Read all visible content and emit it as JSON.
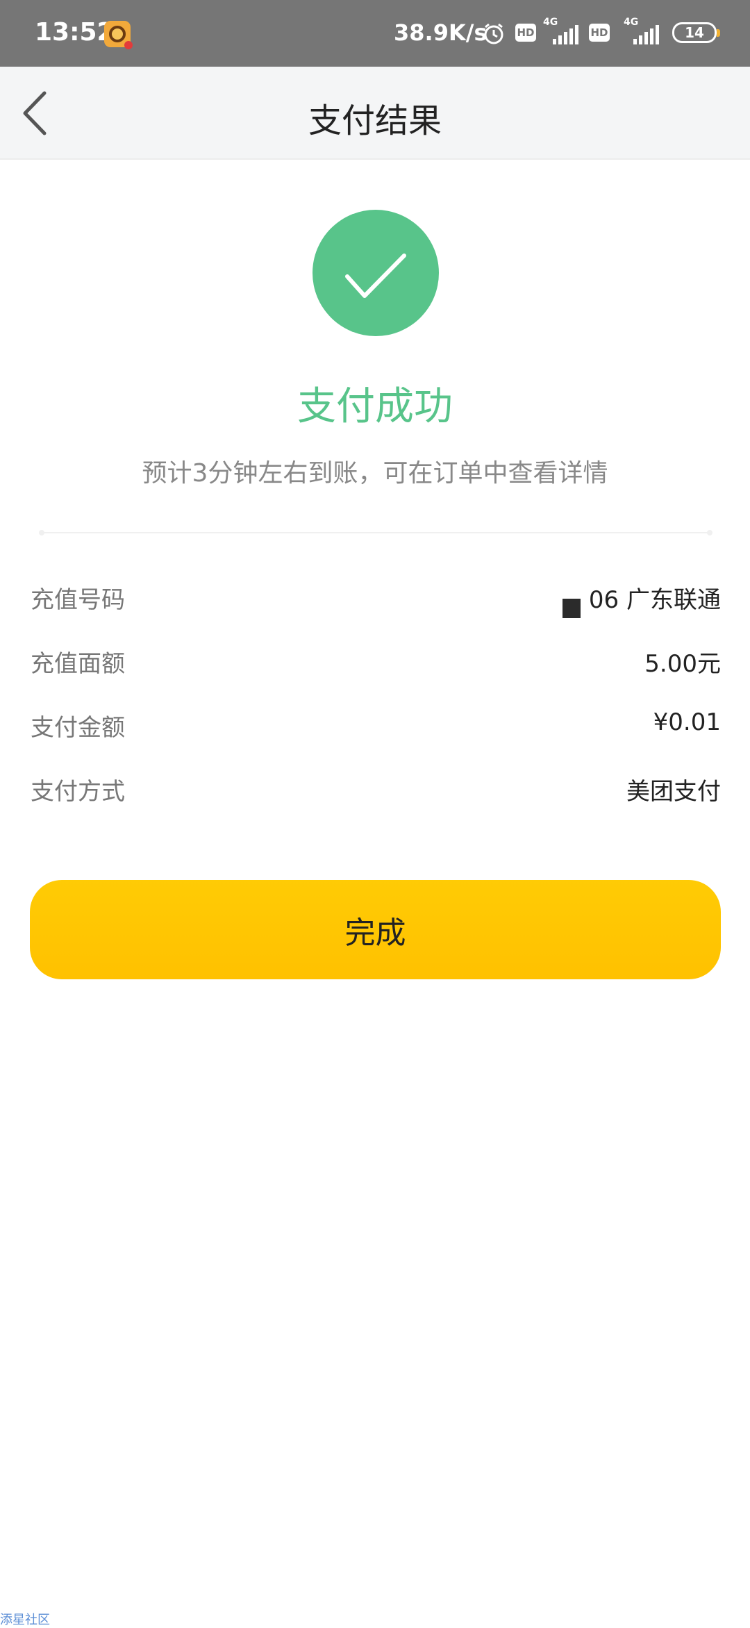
{
  "status_bar": {
    "time": "13:52",
    "net_speed": "38.9K/s",
    "hd_1": "HD",
    "sig_1": "4G",
    "hd_2": "HD",
    "sig_2": "4G",
    "battery": "14"
  },
  "header": {
    "title": "支付结果"
  },
  "result": {
    "title": "支付成功",
    "subtitle": "预计3分钟左右到账，可在订单中查看详情",
    "color": "#58c48a"
  },
  "details": {
    "recharge_number_label": "充值号码",
    "recharge_number_value": "06 广东联通",
    "face_value_label": "充值面额",
    "face_value_value": "5.00元",
    "paid_amount_label": "支付金额",
    "paid_amount_value": "¥0.01",
    "payment_method_label": "支付方式",
    "payment_method_value": "美团支付"
  },
  "actions": {
    "done_label": "完成",
    "done_color": "#ffc300"
  },
  "watermark": "添星社区"
}
